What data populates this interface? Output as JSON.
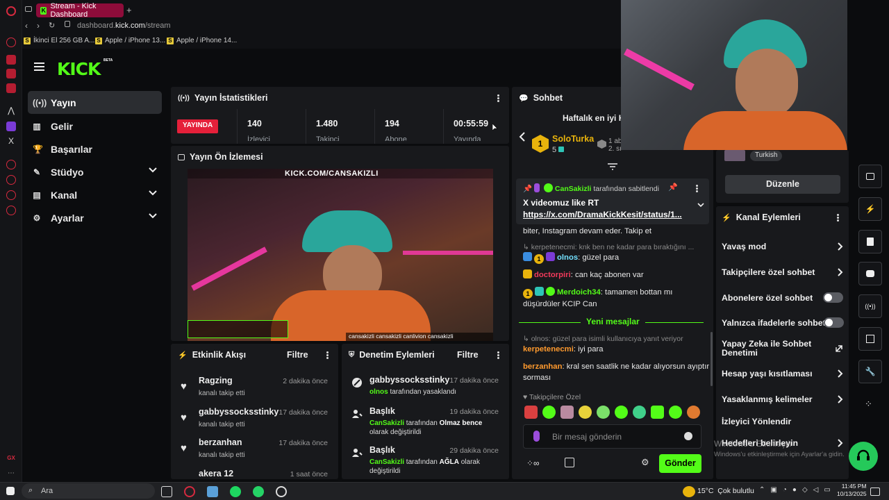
{
  "browser": {
    "tab_title": "Stream - Kick Dashboard",
    "url_prefix": "dashboard.",
    "url_domain": "kick.com",
    "url_path": "/stream",
    "bookmarks": [
      "İkinci El 256 GB A...",
      "Apple / iPhone 13...",
      "Apple / iPhone 14..."
    ]
  },
  "brand": {
    "logo": "KICK",
    "beta": "BETA",
    "accent": "#53fc18"
  },
  "sidebar": {
    "items": [
      {
        "label": "Yayın",
        "icon": "broadcast-icon"
      },
      {
        "label": "Gelir",
        "icon": "chart-icon"
      },
      {
        "label": "Başarılar",
        "icon": "trophy-icon"
      },
      {
        "label": "Stüdyo",
        "icon": "studio-icon"
      },
      {
        "label": "Kanal",
        "icon": "user-icon"
      },
      {
        "label": "Ayarlar",
        "icon": "gear-icon"
      }
    ]
  },
  "stats": {
    "title": "Yayın İstatistikleri",
    "live_label": "YAYINDA",
    "cells": [
      {
        "value": "140",
        "label": "İzleyici"
      },
      {
        "value": "1.480",
        "label": "Takipçi"
      },
      {
        "value": "194",
        "label": "Abone"
      },
      {
        "value": "00:55:59",
        "label": "Yayında"
      }
    ]
  },
  "preview": {
    "title": "Yayın Ön İzlemesi",
    "overlay_url": "KICK.COM/CANSAKIZLI",
    "social_bar": "cansakizli  cansakizli  canlivion  cansakizli"
  },
  "activity": {
    "title": "Etkinlik Akışı",
    "filter": "Filtre",
    "rows": [
      {
        "name": "Ragzing",
        "sub": "kanalı takip etti",
        "time": "2 dakika önce"
      },
      {
        "name": "gabbyssocksstinky",
        "sub": "kanalı takip etti",
        "time": "17 dakika önce"
      },
      {
        "name": "berzanhan",
        "sub": "kanalı takip etti",
        "time": "17 dakika önce"
      },
      {
        "name": "akera 12",
        "sub": "",
        "time": "1 saat önce"
      }
    ]
  },
  "moderation": {
    "title": "Denetim Eylemleri",
    "filter": "Filtre",
    "rows": [
      {
        "name": "gabbyssocksstinky",
        "time": "17 dakika önce",
        "actor": "olnos",
        "text": " tarafından yasaklandı",
        "value": ""
      },
      {
        "name": "Başlık",
        "time": "19 dakika önce",
        "actor": "CanSakizli",
        "text": " tarafından ",
        "value": "Olmaz bence",
        "tail": " olarak değiştirildi"
      },
      {
        "name": "Başlık",
        "time": "29 dakika önce",
        "actor": "CanSakizli",
        "text": " tarafından ",
        "value": "AĞLA",
        "tail": " olarak değiştirildi"
      }
    ]
  },
  "chat": {
    "title": "Sohbet",
    "weekly": "Haftalık en iyi H",
    "top_user": "SoloTurka",
    "top_count": "5",
    "top_rank": "1",
    "second_a": "1 ab",
    "second_b": "2. sı",
    "pinned_by": "CanSakizli",
    "pinned_suffix": " tarafından sabitlendi",
    "pinned_text": "X videomuz like RT",
    "pinned_link": "https://x.com/DramaKickKesit/status/1...",
    "msg_cont": "biter, Instagram devam eder. Takip et",
    "reply1": "kerpetenecmi: knk ben ne kadar para bıraktığını ...",
    "messages": [
      {
        "user": "olnos",
        "text": ": güzel para",
        "color": "#73e0ff"
      },
      {
        "user": "doctorpiri",
        "text": ": can kaç abonen var",
        "color": "#f23a5b"
      },
      {
        "user": "Merdoich34",
        "text": ": tamamen bottan mı düşürdüler KCIP Can",
        "color": "#53fc18"
      }
    ],
    "new_messages": "Yeni mesajlar",
    "reply2": "olnos: güzel para isimli kullanıcıya yanıt veriyor",
    "messages2": [
      {
        "user": "kerpetenecmi",
        "text": ": iyi para",
        "color": "#ff9a2e"
      },
      {
        "user": "berzanhan",
        "text": ": kral sen saatlik ne kadar alıyorsun ayıptır sorması",
        "color": "#ff9a2e"
      }
    ],
    "followers_only": "Takipçilere Özel",
    "input_placeholder": "Bir mesaj gönderin",
    "send": "Gönder"
  },
  "channel": {
    "language": "Turkish",
    "edit": "Düzenle",
    "actions_title": "Kanal Eylemleri",
    "rows": [
      {
        "label": "Yavaş mod",
        "type": "chevron"
      },
      {
        "label": "Takipçilere özel sohbet",
        "type": "chevron"
      },
      {
        "label": "Abonelere özel sohbet",
        "type": "toggle"
      },
      {
        "label": "Yalnızca ifadelerle sohbet",
        "type": "toggle"
      },
      {
        "label": "Yapay Zeka ile Sohbet Denetimi",
        "type": "external"
      },
      {
        "label": "Hesap yaşı kısıtlaması",
        "type": "chevron"
      },
      {
        "label": "Yasaklanmış kelimeler",
        "type": "chevron"
      },
      {
        "label": "İzleyici Yönlendir",
        "type": "none"
      },
      {
        "label": "Hedefleri belirleyin",
        "type": "chevron"
      }
    ]
  },
  "watermark": {
    "line1": "Windows'u Etkinleştir",
    "line2": "Windows'u etkinleştirmek için Ayarlar'a gidin."
  },
  "taskbar": {
    "search": "Ara",
    "weather": "15°C  Çok bulutlu",
    "time": "11:45 PM",
    "date": "10/13/2025"
  }
}
